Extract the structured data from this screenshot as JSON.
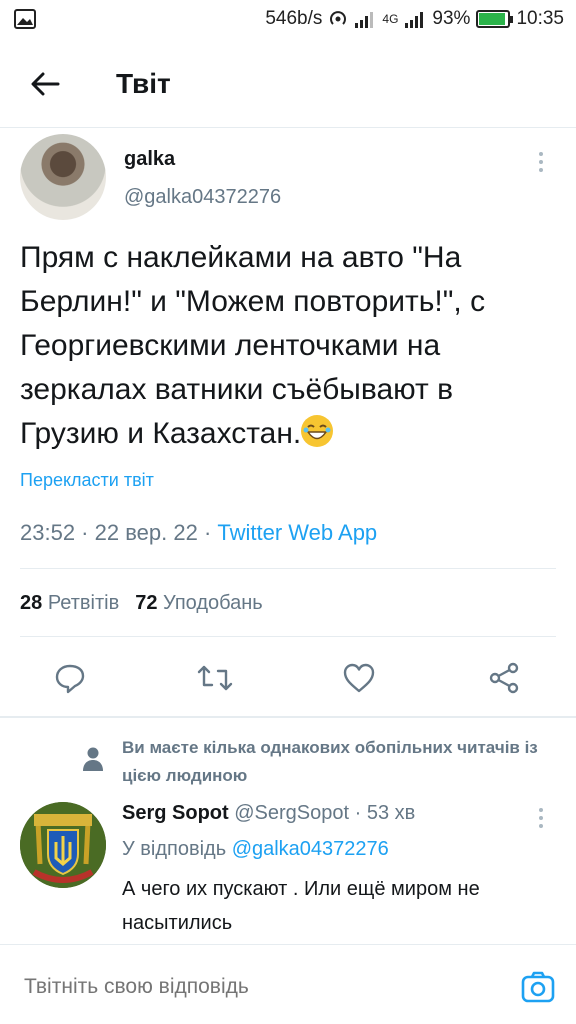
{
  "status_bar": {
    "speed": "546b/s",
    "network": "4G",
    "battery": "93%",
    "battery_level": 0.93,
    "time": "10:35"
  },
  "header": {
    "title": "Твіт"
  },
  "tweet": {
    "author_name": "galka",
    "author_handle": "@galka04372276",
    "text": "Прям с наклейками на авто \"На Берлин!\" и \"Можем повторить!\", с Георгиевскими ленточками на зеркалах ватники съёбывают в Грузию и Казахстан.",
    "translate_label": "Перекласти твіт",
    "time": "23:52",
    "date": "22 вер. 22",
    "separator": " · ",
    "source": "Twitter Web App",
    "retweets_count": "28",
    "retweets_label": "Ретвітів",
    "likes_count": "72",
    "likes_label": "Уподобань"
  },
  "mutual_followers_text": "Ви маєте кілька однакових обопільних читачів із цією людиною",
  "reply": {
    "author_name": "Serg Sopot",
    "author_handle": "@SergSopot",
    "time": "· 53 хв",
    "reply_to_label": "У відповідь",
    "reply_to_handle": "@galka04372276",
    "text": "А чего их пускают . Или ещё миром не насытились"
  },
  "compose": {
    "placeholder": "Твітніть свою відповідь"
  },
  "colors": {
    "accent": "#1da1f2",
    "secondary_text": "#657786",
    "divider": "#e6ecf0"
  }
}
